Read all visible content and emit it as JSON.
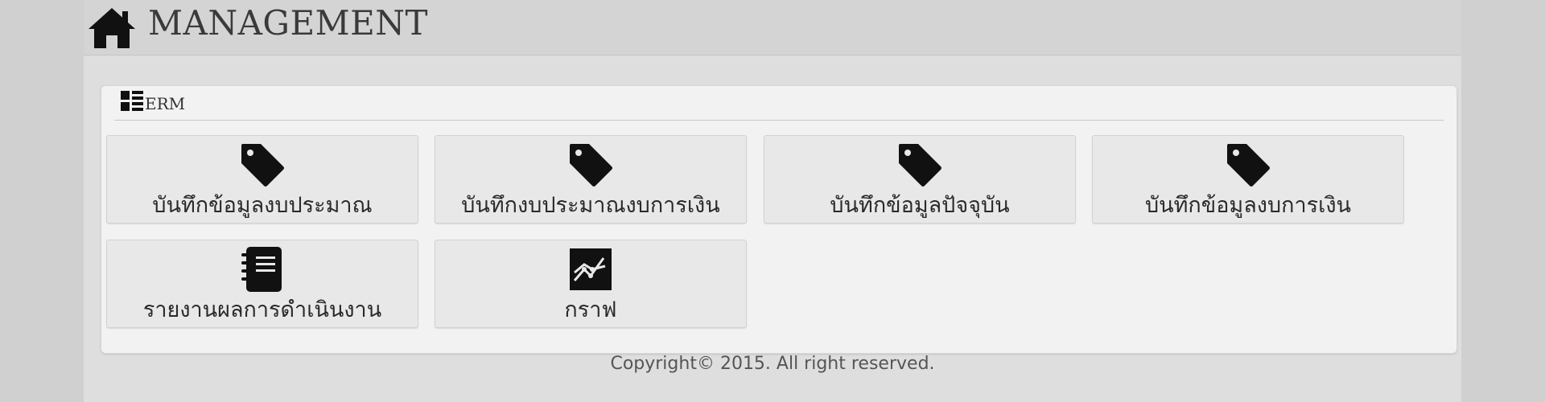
{
  "header": {
    "title": "MANAGEMENT",
    "icon": "home-icon"
  },
  "panel": {
    "title": "ERM",
    "icon": "list-icon"
  },
  "tiles": [
    {
      "label": "บันทึกข้อมูลงบประมาณ",
      "icon": "tag-icon"
    },
    {
      "label": "บันทึกงบประมาณงบการเงิน",
      "icon": "tag-icon"
    },
    {
      "label": "บันทึกข้อมูลปัจจุบัน",
      "icon": "tag-icon"
    },
    {
      "label": "บันทึกข้อมูลงบการเงิน",
      "icon": "tag-icon"
    },
    {
      "label": "รายงานผลการดำเนินงาน",
      "icon": "notebook-icon"
    },
    {
      "label": "กราฟ",
      "icon": "chart-icon"
    }
  ],
  "footer": {
    "copyright": "Copyright© 2015. All right reserved."
  },
  "colors": {
    "background": "#d0d0d0",
    "panel": "#f2f2f2",
    "tile": "#e8e8e8",
    "icon": "#111111"
  }
}
